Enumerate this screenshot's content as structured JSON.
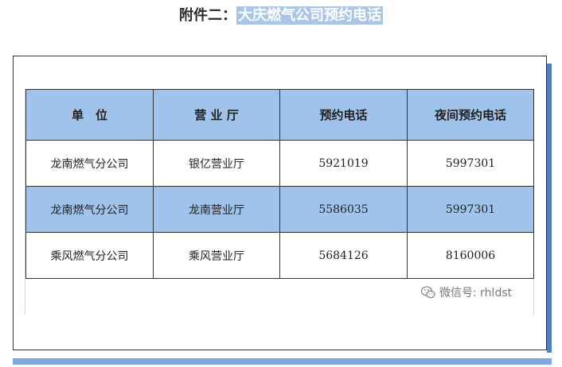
{
  "title": {
    "prefix": "附件二：",
    "highlight": "大庆燃气公司预约电话"
  },
  "table": {
    "headers": [
      "单　位",
      "营 业 厅",
      "预约电话",
      "夜间预约电话"
    ],
    "rows": [
      [
        "龙南燃气分公司",
        "银亿营业厅",
        "5921019",
        "5997301"
      ],
      [
        "龙南燃气分公司",
        "龙南营业厅",
        "5586035",
        "5997301"
      ],
      [
        "乘风燃气分公司",
        "乘风营业厅",
        "5684126",
        "8160006"
      ]
    ]
  },
  "watermark": {
    "text": "微信号: rhldst",
    "icon": "wechat-icon"
  },
  "colors": {
    "header_fill": "#9fc3ea",
    "title_highlight": "#a9c6ea",
    "accent_bar": "#4a7fcf"
  }
}
